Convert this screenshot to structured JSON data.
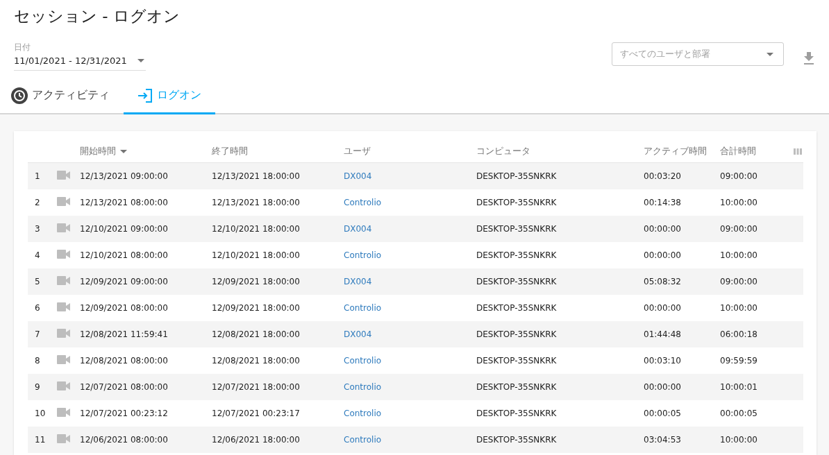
{
  "title": "セッション - ログオン",
  "date_filter": {
    "label": "日付",
    "value": "11/01/2021 - 12/31/2021"
  },
  "user_filter": {
    "placeholder": "すべてのユーザと部署"
  },
  "tabs": [
    {
      "label": "アクティビティ",
      "kind": "activity",
      "selected": false
    },
    {
      "label": "ログオン",
      "kind": "logon",
      "selected": true
    }
  ],
  "table": {
    "columns": [
      "開始時間",
      "終了時間",
      "ユーザ",
      "コンピュータ",
      "アクティブ時間",
      "合計時間"
    ],
    "rows": [
      {
        "index": "1",
        "start": "12/13/2021 09:00:00",
        "end": "12/13/2021 18:00:00",
        "user": "DX004",
        "computer": "DESKTOP-35SNKRK",
        "active": "00:03:20",
        "total": "09:00:00"
      },
      {
        "index": "2",
        "start": "12/13/2021 08:00:00",
        "end": "12/13/2021 18:00:00",
        "user": "Controlio",
        "computer": "DESKTOP-35SNKRK",
        "active": "00:14:38",
        "total": "10:00:00"
      },
      {
        "index": "3",
        "start": "12/10/2021 09:00:00",
        "end": "12/10/2021 18:00:00",
        "user": "DX004",
        "computer": "DESKTOP-35SNKRK",
        "active": "00:00:00",
        "total": "09:00:00"
      },
      {
        "index": "4",
        "start": "12/10/2021 08:00:00",
        "end": "12/10/2021 18:00:00",
        "user": "Controlio",
        "computer": "DESKTOP-35SNKRK",
        "active": "00:00:00",
        "total": "10:00:00"
      },
      {
        "index": "5",
        "start": "12/09/2021 09:00:00",
        "end": "12/09/2021 18:00:00",
        "user": "DX004",
        "computer": "DESKTOP-35SNKRK",
        "active": "05:08:32",
        "total": "09:00:00"
      },
      {
        "index": "6",
        "start": "12/09/2021 08:00:00",
        "end": "12/09/2021 18:00:00",
        "user": "Controlio",
        "computer": "DESKTOP-35SNKRK",
        "active": "00:00:00",
        "total": "10:00:00"
      },
      {
        "index": "7",
        "start": "12/08/2021 11:59:41",
        "end": "12/08/2021 18:00:00",
        "user": "DX004",
        "computer": "DESKTOP-35SNKRK",
        "active": "01:44:48",
        "total": "06:00:18"
      },
      {
        "index": "8",
        "start": "12/08/2021 08:00:00",
        "end": "12/08/2021 18:00:00",
        "user": "Controlio",
        "computer": "DESKTOP-35SNKRK",
        "active": "00:03:10",
        "total": "09:59:59"
      },
      {
        "index": "9",
        "start": "12/07/2021 08:00:00",
        "end": "12/07/2021 18:00:00",
        "user": "Controlio",
        "computer": "DESKTOP-35SNKRK",
        "active": "00:00:00",
        "total": "10:00:01"
      },
      {
        "index": "10",
        "start": "12/07/2021 00:23:12",
        "end": "12/07/2021 00:23:17",
        "user": "Controlio",
        "computer": "DESKTOP-35SNKRK",
        "active": "00:00:05",
        "total": "00:00:05"
      },
      {
        "index": "11",
        "start": "12/06/2021 08:00:00",
        "end": "12/06/2021 18:00:00",
        "user": "Controlio",
        "computer": "DESKTOP-35SNKRK",
        "active": "03:04:53",
        "total": "10:00:00"
      }
    ]
  }
}
